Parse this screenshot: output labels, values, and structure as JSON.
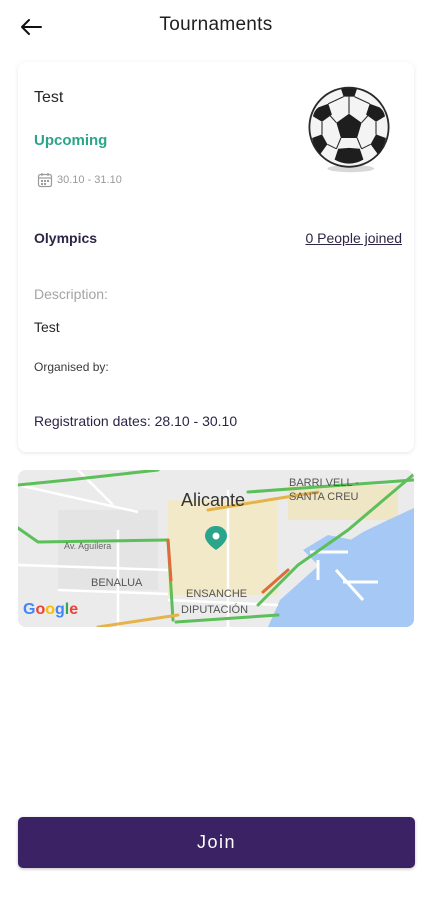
{
  "header": {
    "title": "Tournaments",
    "back_icon": "arrow-left-icon"
  },
  "tournament": {
    "name": "Test",
    "status": "Upcoming",
    "dates": "30.10 - 31.10",
    "sport": "Olympics",
    "people_joined": "0 People joined",
    "description_label": "Description:",
    "description": "Test",
    "organised_by_label": "Organised by:",
    "registration_dates": "Registration dates: 28.10 - 30.10",
    "image_icon": "soccer-ball-icon"
  },
  "map": {
    "city_label": "Alicante",
    "district_1": "BARRI VELL -",
    "district_2": "SANTA CREU",
    "district_3": "BENALUA",
    "district_4": "ENSANCHE",
    "district_5": "DIPUTACIÓN",
    "street": "Av. Aguilera",
    "provider": "Google",
    "marker_icon": "map-pin-icon"
  },
  "actions": {
    "join_label": "Join"
  },
  "colors": {
    "primary": "#3b2264",
    "status_green": "#2aa58a",
    "text_dark": "#2e2446",
    "water": "#a6c8f5"
  }
}
